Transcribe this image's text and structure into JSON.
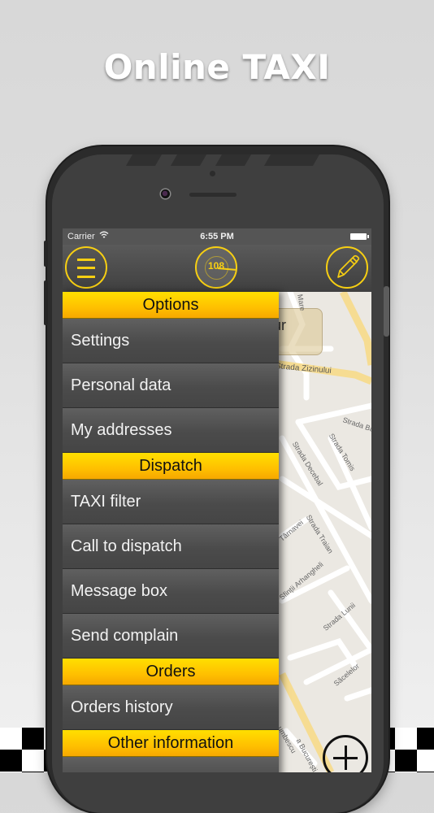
{
  "headline": "Online TAXI",
  "status_bar": {
    "carrier": "Carrier",
    "time": "6:55 PM"
  },
  "nav": {
    "menu_icon": "hamburger-icon",
    "radar_count": "108",
    "edit_icon": "pencil-icon"
  },
  "drawer": {
    "sections": [
      {
        "title": "Options",
        "items": [
          "Settings",
          "Personal data",
          "My addresses"
        ]
      },
      {
        "title": "Dispatch",
        "items": [
          "TAXI filter",
          "Call to dispatch",
          "Message box",
          "Send complain"
        ]
      },
      {
        "title": "Orders",
        "items": [
          "Orders history"
        ]
      },
      {
        "title": "Other information",
        "items": []
      }
    ]
  },
  "map": {
    "bubble_text": "our",
    "streets": [
      "Mare",
      "Strada Zizinului",
      "Strada Babe",
      "Strada Decebal",
      "Strada Tomis",
      "Strada Traian",
      "Târnavei",
      "Sfinții Arhangheli",
      "Strada Lunii",
      "Săcelelor",
      "a București",
      "umbescu"
    ]
  },
  "colors": {
    "accent": "#f7cf12",
    "header_yellow": "#ffc000",
    "menu_bg": "#4b4b4b"
  }
}
